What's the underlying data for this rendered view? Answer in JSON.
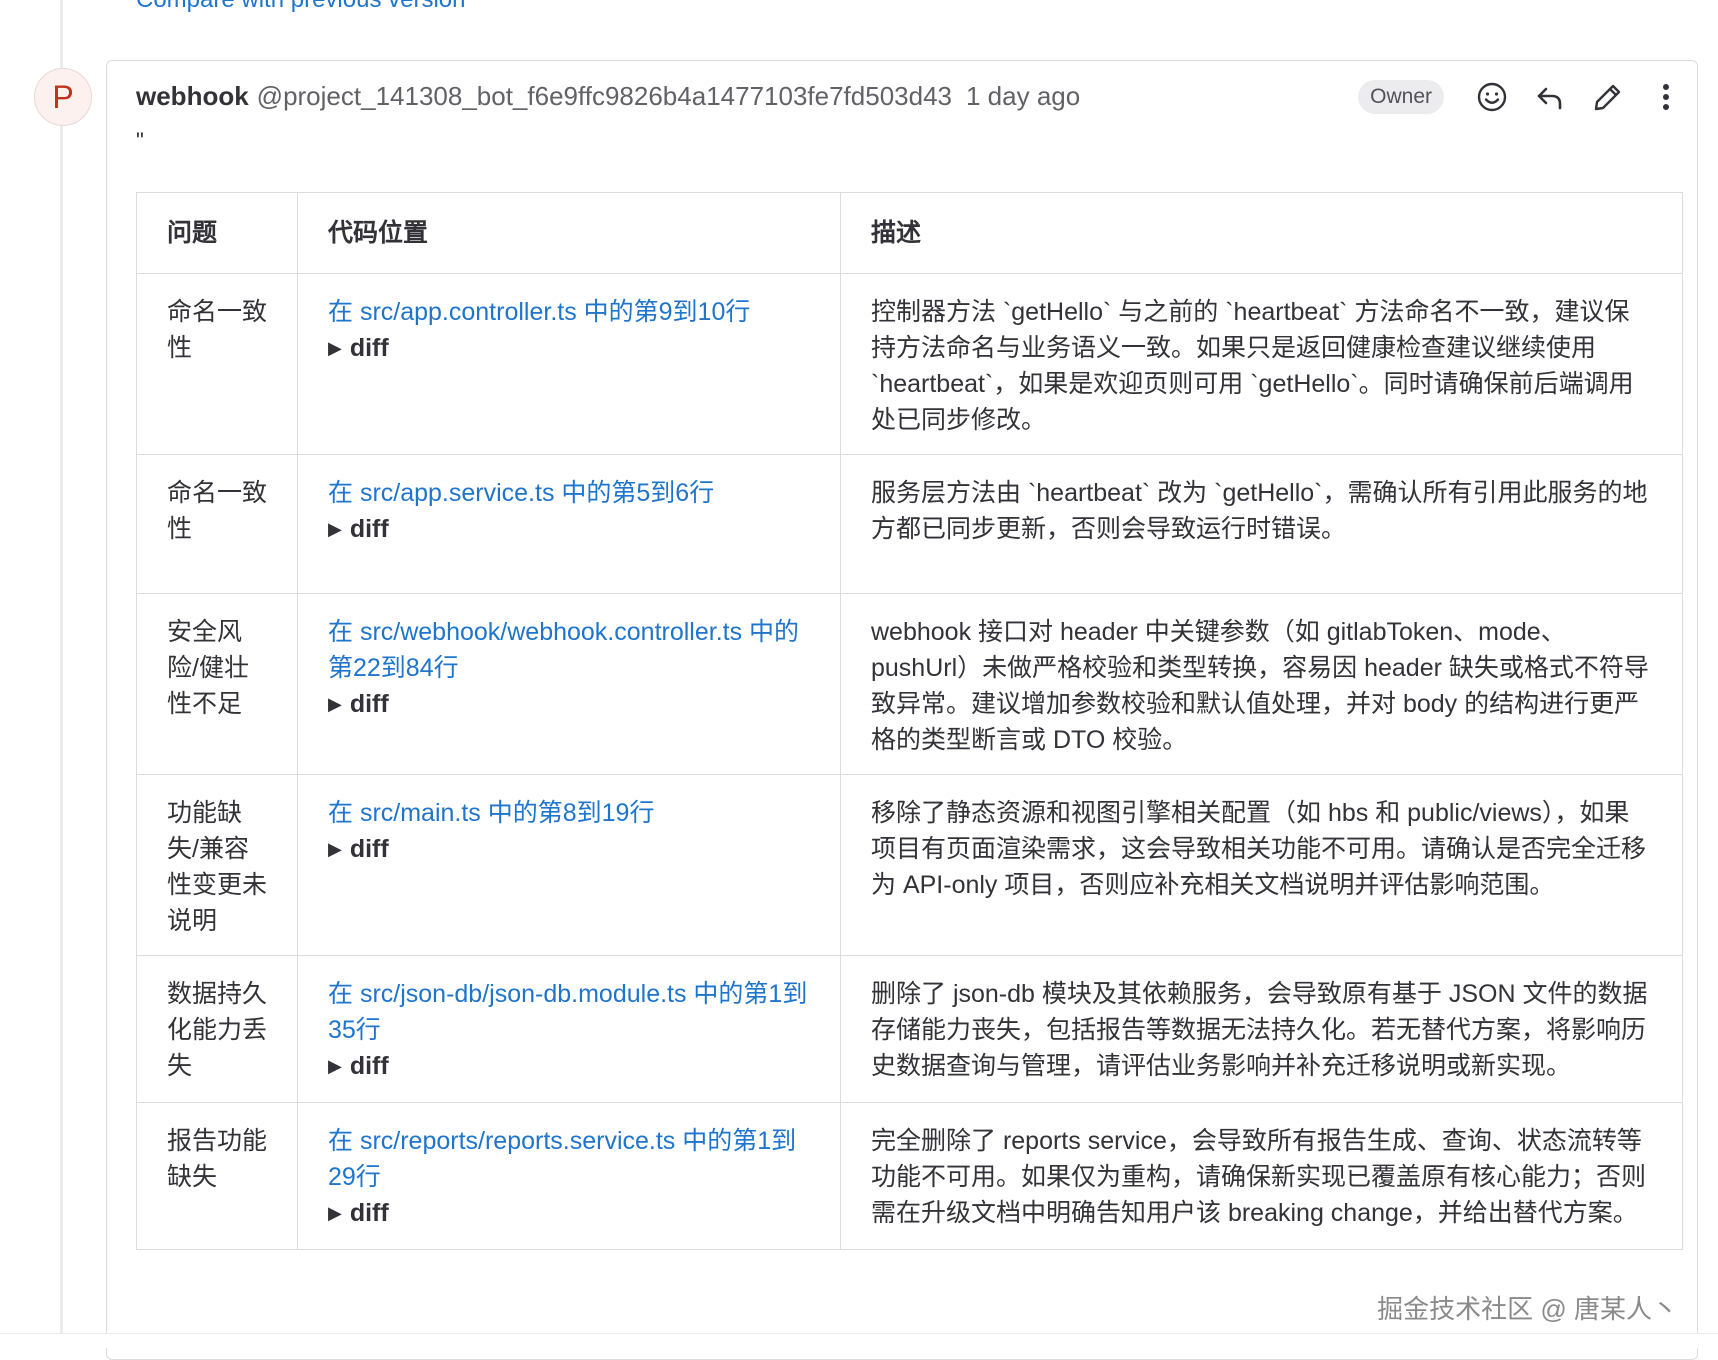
{
  "compare_link": "Compare with previous version",
  "note": {
    "avatar_letter": "P",
    "author": "webhook",
    "handle": "@project_141308_bot_f6e9ffc9826b4a1477103fe7fd503d43",
    "time": "1 day ago",
    "role": "Owner",
    "quote": "\"",
    "icons": [
      "smiley-icon",
      "reply-icon",
      "pencil-icon",
      "kebab-menu-icon"
    ]
  },
  "table": {
    "headers": [
      "问题",
      "代码位置",
      "描述"
    ],
    "diff_label": "diff",
    "rows": [
      {
        "issue": "命名一致性",
        "location": "在 src/app.controller.ts 中的第9到10行",
        "description": "控制器方法 `getHello` 与之前的 `heartbeat` 方法命名不一致，建议保持方法命名与业务语义一致。如果只是返回健康检查建议继续使用 `heartbeat`，如果是欢迎页则可用 `getHello`。同时请确保前后端调用处已同步修改。"
      },
      {
        "issue": "命名一致性",
        "location": "在 src/app.service.ts 中的第5到6行",
        "description": "服务层方法由 `heartbeat` 改为 `getHello`，需确认所有引用此服务的地方都已同步更新，否则会导致运行时错误。"
      },
      {
        "issue": "安全风险/健壮性不足",
        "location": "在 src/webhook/webhook.controller.ts 中的第22到84行",
        "description": "webhook 接口对 header 中关键参数（如 gitlabToken、mode、pushUrl）未做严格校验和类型转换，容易因 header 缺失或格式不符导致异常。建议增加参数校验和默认值处理，并对 body 的结构进行更严格的类型断言或 DTO 校验。"
      },
      {
        "issue": "功能缺失/兼容性变更未说明",
        "location": "在 src/main.ts 中的第8到19行",
        "description": "移除了静态资源和视图引擎相关配置（如 hbs 和 public/views），如果项目有页面渲染需求，这会导致相关功能不可用。请确认是否完全迁移为 API-only 项目，否则应补充相关文档说明并评估影响范围。"
      },
      {
        "issue": "数据持久化能力丢失",
        "location": "在 src/json-db/json-db.module.ts 中的第1到35行",
        "description": "删除了 json-db 模块及其依赖服务，会导致原有基于 JSON 文件的数据存储能力丧失，包括报告等数据无法持久化。若无替代方案，将影响历史数据查询与管理，请评估业务影响并补充迁移说明或新实现。"
      },
      {
        "issue": "报告功能缺失",
        "location": "在 src/reports/reports.service.ts 中的第1到29行",
        "description": "完全删除了 reports service，会导致所有报告生成、查询、状态流转等功能不可用。如果仅为重构，请确保新实现已覆盖原有核心能力；否则需在升级文档中明确告知用户该 breaking change，并给出替代方案。"
      }
    ]
  },
  "watermark": "掘金技术社区 @ 唐某人丶"
}
